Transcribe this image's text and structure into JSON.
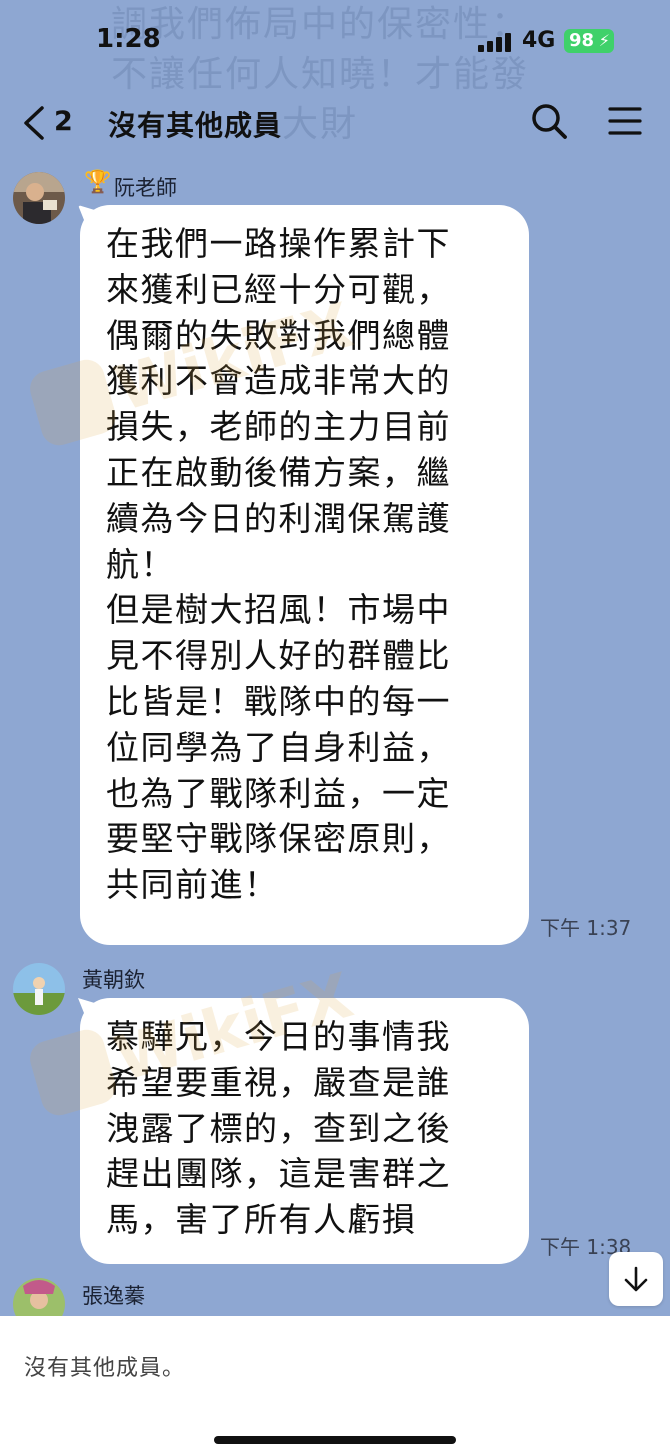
{
  "status_bar": {
    "time": "1:28",
    "network": "4G",
    "battery": "98"
  },
  "background_notice": "調我們佈局中的保密性：不讓任何人知曉！才能發大財",
  "header": {
    "back_count": "2",
    "title": "沒有其他成員"
  },
  "messages": [
    {
      "sender": "阮老師",
      "text": "在我們一路操作累計下\n來獲利已經十分可觀，\n偶爾的失敗對我們總體\n獲利不會造成非常大的\n損失，老師的主力目前\n正在啟動後備方案，繼\n續為今日的利潤保駕護\n航！\n但是樹大招風！市場中\n見不得別人好的群體比\n比皆是！戰隊中的每一\n位同學為了自身利益，\n也為了戰隊利益，一定\n要堅守戰隊保密原則，\n共同前進！",
      "time": "下午 1:37"
    },
    {
      "sender": "黃朝欽",
      "text": "慕驊兄，今日的事情我\n希望要重視，嚴查是誰\n洩露了標的，查到之後\n趕出團隊，這是害群之\n馬，害了所有人虧損",
      "time": "下午 1:38"
    },
    {
      "sender": "張逸蓁"
    }
  ],
  "watermark": "WikiFX",
  "footer": {
    "text": "沒有其他成員。"
  },
  "colors": {
    "background": "#8ea7d2",
    "bubble": "#ffffff",
    "battery": "#3fd16a"
  }
}
